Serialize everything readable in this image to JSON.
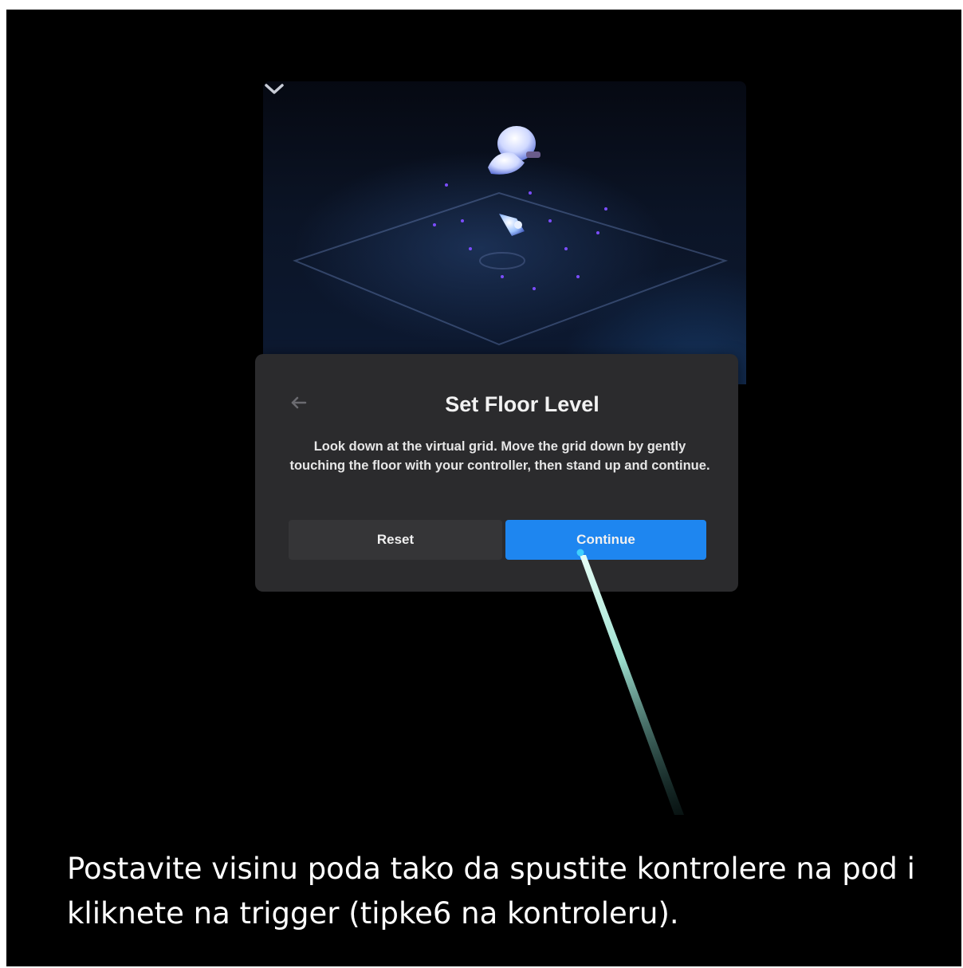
{
  "dialog": {
    "title": "Set Floor Level",
    "body": "Look down at the virtual grid. Move the grid down by gently touching the floor with your controller, then stand up and continue.",
    "reset_label": "Reset",
    "continue_label": "Continue"
  },
  "caption": {
    "text": "Postavite visinu poda tako da spustite kontrolere na pod i kliknete na trigger (tipke6 na kontroleru)."
  },
  "colors": {
    "accent": "#1e86f0",
    "dialog_bg": "#2b2b2d",
    "background": "#000000"
  },
  "icons": {
    "collapse": "chevron-down-icon",
    "back": "back-arrow-icon",
    "headset": "vr-headset-icon",
    "controller": "controller-icon"
  }
}
